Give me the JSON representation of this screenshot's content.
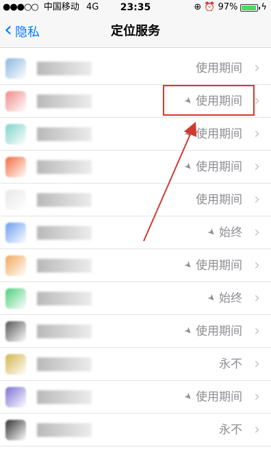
{
  "status_bar": {
    "carrier": "中国移动",
    "network": "4G",
    "time": "23:35",
    "battery_percent": "97%",
    "signal_dots": "●●●○○",
    "battery_level": 0.97
  },
  "nav": {
    "back_label": "隐私",
    "title": "定位服务"
  },
  "rows": [
    {
      "status": "使用期间",
      "location_arrow": false,
      "icon_color": "#8ab6e0"
    },
    {
      "status": "使用期间",
      "location_arrow": true,
      "icon_color": "#f08a8a"
    },
    {
      "status": "使用期间",
      "location_arrow": true,
      "icon_color": "#7ed3c9"
    },
    {
      "status": "使用期间",
      "location_arrow": true,
      "icon_color": "#f26a3c"
    },
    {
      "status": "使用期间",
      "location_arrow": false,
      "icon_color": "#e8e8e8"
    },
    {
      "status": "始终",
      "location_arrow": true,
      "icon_color": "#6c9ef0"
    },
    {
      "status": "使用期间",
      "location_arrow": true,
      "icon_color": "#f2a65a"
    },
    {
      "status": "始终",
      "location_arrow": true,
      "icon_color": "#4ccf7a"
    },
    {
      "status": "使用期间",
      "location_arrow": true,
      "icon_color": "#555555"
    },
    {
      "status": "永不",
      "location_arrow": false,
      "icon_color": "#d4b44a"
    },
    {
      "status": "使用期间",
      "location_arrow": true,
      "icon_color": "#7b6fd4"
    },
    {
      "status": "永不",
      "location_arrow": false,
      "icon_color": "#333333"
    }
  ],
  "glyphs": {
    "back_chevron": "‹",
    "row_chevron": "›",
    "location_arrow": "➤"
  },
  "annotation": {
    "color": "#d2382c"
  }
}
